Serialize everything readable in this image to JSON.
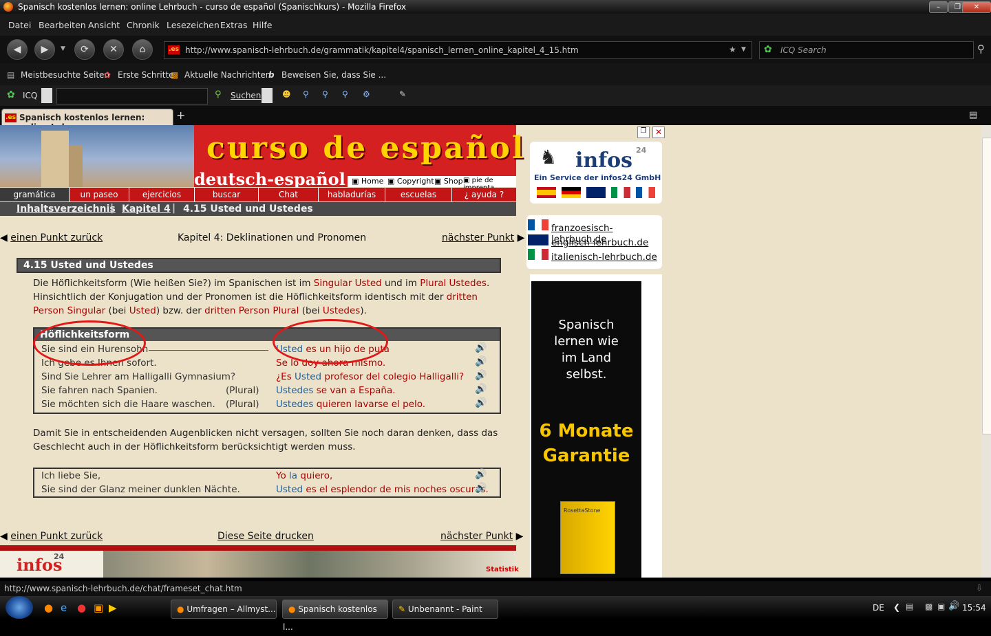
{
  "window": {
    "title": "Spanisch kostenlos lernen: online Lehrbuch - curso de español (Spanischkurs) - Mozilla Firefox"
  },
  "menu": [
    "Datei",
    "Bearbeiten",
    "Ansicht",
    "Chronik",
    "Lesezeichen",
    "Extras",
    "Hilfe"
  ],
  "url": "http://www.spanisch-lehrbuch.de/grammatik/kapitel4/spanisch_lernen_online_kapitel_4_15.htm",
  "search_placeholder": "ICQ Search",
  "bookmarks": [
    "Meistbesuchte Seiten",
    "Erste Schritte",
    "Aktuelle Nachrichten",
    "Beweisen Sie, dass Sie ..."
  ],
  "icqbar": {
    "icq": "ICQ",
    "search": "Suchen"
  },
  "tab": {
    "title": "Spanisch kostenlos lernen: online Leh...",
    "favicon": ".es",
    "new": "+"
  },
  "header": {
    "title": "curso de español",
    "subtitle": "deutsch-español",
    "links": [
      "Home",
      "Copyright",
      "Shop",
      "pie de imprenta"
    ],
    "nav": [
      "gramática",
      "un paseo",
      "ejercicios",
      "buscar",
      "Chat",
      "habladurías",
      "escuelas",
      "¿ ayuda ?"
    ],
    "breadcrumb": {
      "toc": "Inhaltsverzeichnis",
      "chapter": "Kapitel 4",
      "current": "4.15 Usted und Ustedes"
    }
  },
  "pager_top": {
    "prev": "einen Punkt zurück",
    "center": "Kapitel 4: Deklinationen und Pronomen",
    "next": "nächster Punkt"
  },
  "section": {
    "title": "4.15 Usted und Ustedes",
    "intro": {
      "p1": "Die Höflichkeitsform (Wie heißen Sie?) im Spanischen ist im ",
      "r1": "Singular Usted",
      "p2": " und im ",
      "r2": "Plural Ustedes",
      "p3": ". Hinsichtlich der Konjugation und der Pronomen ist die Höflichkeitsform identisch mit der ",
      "r3": "dritten Person Singular",
      "p4": " (bei ",
      "r4": "Usted",
      "p5": ") bzw. der ",
      "r5": "dritten Person Plural",
      "p6": " (bei ",
      "r6": "Ustedes",
      "p7": ")."
    },
    "table1": {
      "header": "Höflichkeitsform",
      "rows": [
        {
          "de": "Sie sind ein Hurensohn",
          "note": "",
          "b": "Usted",
          "r": "es un hijo de puta"
        },
        {
          "de": "Ich gebe es Ihnen sofort.",
          "note": "",
          "b": "",
          "r": "Se lo doy ahora mismo."
        },
        {
          "de": "Sind Sie Lehrer am Halligalli Gymnasium?",
          "note": "",
          "pre": "¿Es ",
          "b": "Usted",
          "r": " profesor del colegio Halligalli?"
        },
        {
          "de": "Sie fahren nach Spanien.",
          "note": "(Plural)",
          "b": "Ustedes",
          "r": "se van a España."
        },
        {
          "de": "Sie möchten sich die Haare waschen.",
          "note": "(Plural)",
          "b": "Ustedes",
          "r": "quieren lavarse el pelo."
        }
      ]
    },
    "para2": "Damit Sie in entscheidenden Augenblicken nicht versagen, sollten Sie noch daran denken, dass das Geschlecht auch in der Höflichkeitsform berücksichtigt werden muss.",
    "table2": {
      "rows": [
        {
          "de": "Ich liebe Sie,",
          "r1": "Yo ",
          "b": "la",
          "r2": " quiero,"
        },
        {
          "de": "Sie sind der Glanz meiner dunklen Nächte.",
          "b": "Usted",
          "r2": " es el esplendor de mis noches oscuras."
        }
      ]
    }
  },
  "pager_bottom": {
    "prev": "einen Punkt zurück",
    "center": "Diese Seite drucken",
    "next": "nächster Punkt"
  },
  "footer": {
    "logo": "infos",
    "logo_num": "24",
    "stat": "Statistik"
  },
  "sidebar": {
    "infos_logo": "infos",
    "infos_num": "24",
    "infos_caption": "Ein Service der infos24 GmbH",
    "links": [
      "franzoesisch-lehrbuch.de",
      "englisch-lehrbuch.de",
      "italienisch-lehrbuch.de"
    ],
    "ad": {
      "line1": "Spanisch",
      "line2": "lernen wie",
      "line3": "im Land",
      "line4": "selbst.",
      "big1": "6 Monate",
      "big2": "Garantie",
      "box": "RosettaStone"
    }
  },
  "status": "http://www.spanisch-lehrbuch.de/chat/frameset_chat.htm",
  "taskbar": {
    "tasks": [
      "Umfragen – Allmyst...",
      "Spanisch kostenlos l...",
      "Unbenannt - Paint"
    ],
    "lang": "DE",
    "clock": "15:54"
  }
}
